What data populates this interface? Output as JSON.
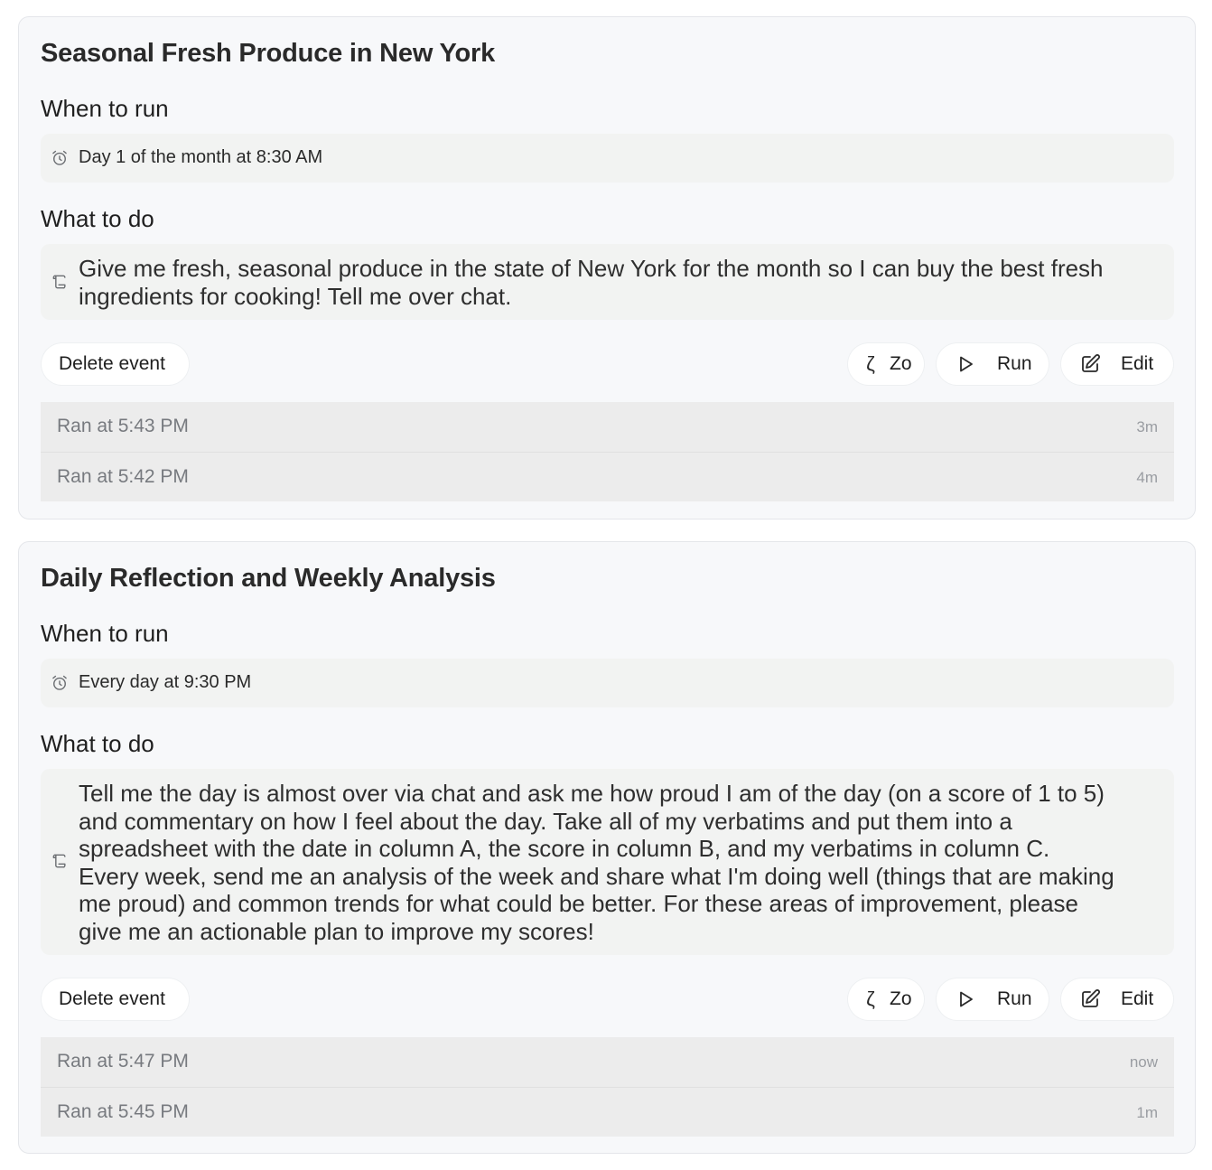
{
  "events": [
    {
      "title": "Seasonal Fresh Produce in New York",
      "when_label": "When to run",
      "schedule": "Day 1 of the month at 8:30 AM",
      "what_label": "What to do",
      "prompt_lines": [
        "Give me fresh, seasonal produce in the state of New York for the month so I can buy the best fresh",
        "ingredients for cooking! Tell me over chat."
      ],
      "buttons": {
        "delete": "Delete event",
        "zo": "Zo",
        "run": "Run",
        "edit": "Edit"
      },
      "runs": [
        {
          "label": "Ran at 5:43 PM",
          "age": "3m"
        },
        {
          "label": "Ran at 5:42 PM",
          "age": "4m"
        }
      ]
    },
    {
      "title": "Daily Reflection and Weekly Analysis",
      "when_label": "When to run",
      "schedule": "Every day at 9:30 PM",
      "what_label": "What to do",
      "prompt_lines": [
        "Tell me the day is almost over via chat and ask me how proud I am of the day (on a score of 1 to 5)",
        "and commentary on how I feel about the day. Take all of my verbatims and put them into a",
        "spreadsheet with the date in column A, the score in column B, and my verbatims in column C.",
        "Every week, send me an analysis of the week and share what I'm doing well (things that are making",
        "me proud) and common trends for what could be better. For these areas of improvement, please",
        "give me an actionable plan to improve my scores!"
      ],
      "buttons": {
        "delete": "Delete event",
        "zo": "Zo",
        "run": "Run",
        "edit": "Edit"
      },
      "runs": [
        {
          "label": "Ran at 5:47 PM",
          "age": "now"
        },
        {
          "label": "Ran at 5:45 PM",
          "age": "1m"
        }
      ]
    }
  ],
  "icons": {
    "schedule": "alarm-clock-icon",
    "prompt": "scroll-icon",
    "zo": "zo-logo-icon",
    "run": "play-icon",
    "edit": "edit-icon"
  }
}
